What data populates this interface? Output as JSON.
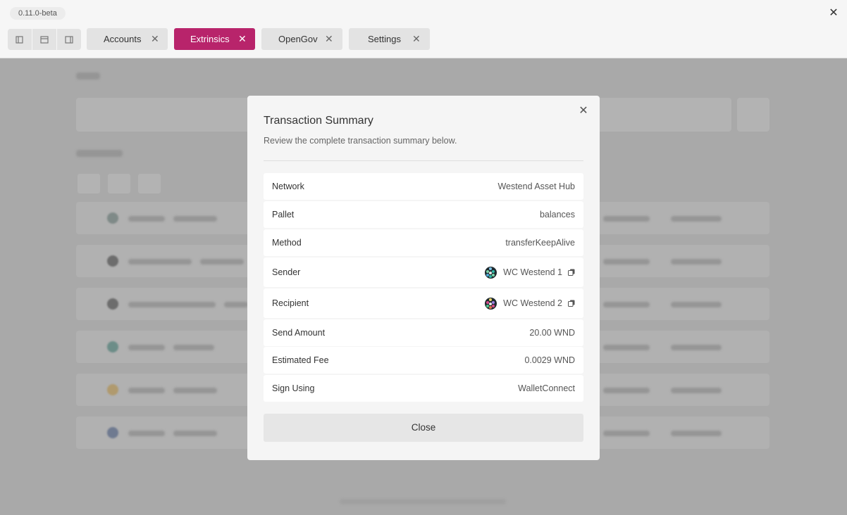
{
  "app": {
    "version": "0.11.0-beta"
  },
  "tabs": [
    {
      "label": "Accounts",
      "active": false
    },
    {
      "label": "Extrinsics",
      "active": true
    },
    {
      "label": "OpenGov",
      "active": false
    },
    {
      "label": "Settings",
      "active": false
    }
  ],
  "colors": {
    "accent": "#b8246b",
    "overlay": "#a9a9a9",
    "modal_bg": "#f5f5f5"
  },
  "modal": {
    "title": "Transaction Summary",
    "subtitle": "Review the complete transaction summary below.",
    "rows": [
      {
        "label": "Network",
        "value": "Westend Asset Hub"
      },
      {
        "label": "Pallet",
        "value": "balances"
      },
      {
        "label": "Method",
        "value": "transferKeepAlive"
      },
      {
        "label": "Sender",
        "value": "WC Westend 1",
        "icon": "identicon",
        "copy_icon": "copy-icon"
      },
      {
        "label": "Recipient",
        "value": "WC Westend 2",
        "icon": "identicon",
        "copy_icon": "copy-icon"
      },
      {
        "label": "Send Amount",
        "value": "20.00 WND"
      },
      {
        "label": "Estimated Fee",
        "value": "0.0029 WND"
      },
      {
        "label": "Sign Using",
        "value": "WalletConnect"
      }
    ],
    "close_button": "Close"
  }
}
